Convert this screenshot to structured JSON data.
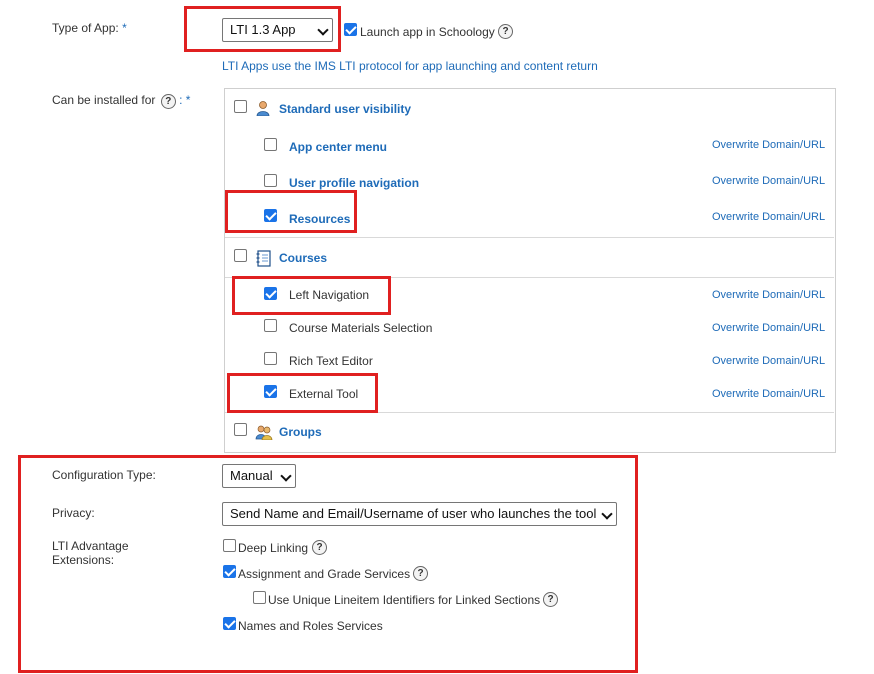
{
  "type_of_app": {
    "label": "Type of App:",
    "required": "*",
    "selected": "LTI 1.3 App",
    "launch_label": "Launch app in Schoology",
    "launch_checked": true,
    "help": "?",
    "note": "LTI Apps use the IMS LTI protocol for app launching and content return"
  },
  "install_for": {
    "label": "Can be installed for",
    "help": "?",
    "colon_required": ": *",
    "overwrite_label": "Overwrite Domain/URL",
    "standard": {
      "label": "Standard user visibility",
      "icon": "user-icon",
      "items": [
        {
          "label": "App center menu",
          "checked": false
        },
        {
          "label": "User profile navigation",
          "checked": false
        },
        {
          "label": "Resources",
          "checked": true
        }
      ]
    },
    "courses": {
      "label": "Courses",
      "icon": "notebook-icon",
      "items": [
        {
          "label": "Left Navigation",
          "checked": true
        },
        {
          "label": "Course Materials Selection",
          "checked": false
        },
        {
          "label": "Rich Text Editor",
          "checked": false
        },
        {
          "label": "External Tool",
          "checked": true
        }
      ]
    },
    "groups": {
      "label": "Groups",
      "icon": "group-icon"
    }
  },
  "configuration": {
    "config_type_label": "Configuration Type:",
    "config_type_value": "Manual",
    "privacy_label": "Privacy:",
    "privacy_value": "Send Name and Email/Username of user who launches the tool",
    "extensions_label_line1": "LTI Advantage",
    "extensions_label_line2": "Extensions:",
    "help": "?",
    "extensions": [
      {
        "label": "Deep Linking",
        "checked": false
      },
      {
        "label": "Assignment and Grade Services",
        "checked": true
      },
      {
        "label": "Use Unique Lineitem Identifiers for Linked Sections",
        "checked": false
      },
      {
        "label": "Names and Roles Services",
        "checked": true
      }
    ]
  },
  "colors": {
    "accent_blue": "#1e6bb8",
    "highlight_red": "#e02020",
    "checkbox_blue": "#1a73e8"
  }
}
